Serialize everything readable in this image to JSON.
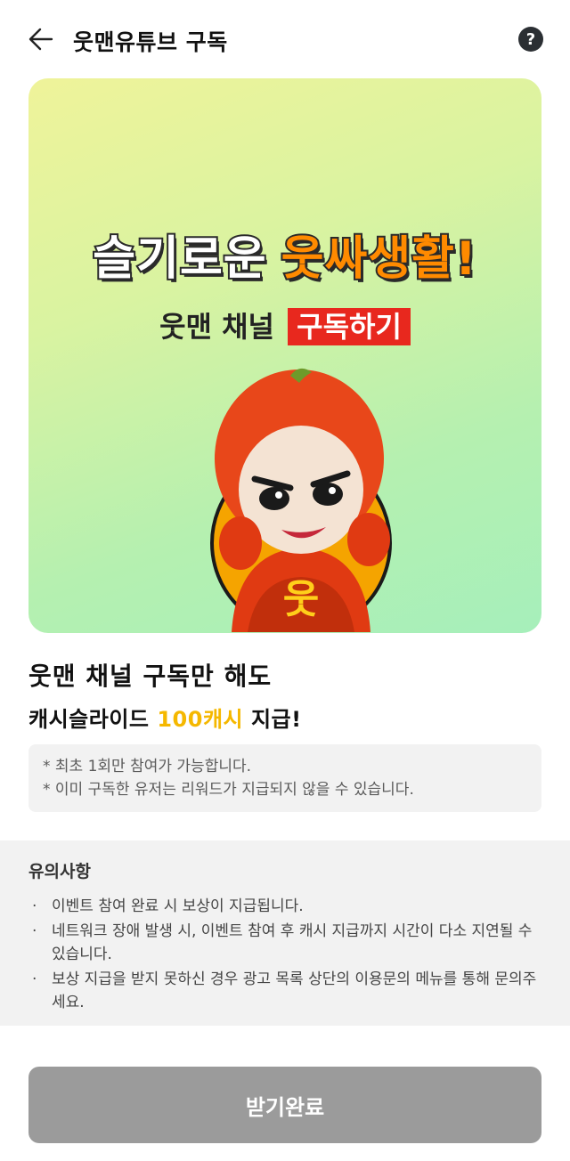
{
  "header": {
    "back_icon": "back-arrow-icon",
    "title": "웃맨유튜브 구독",
    "help_icon": "help-icon",
    "help_glyph": "?"
  },
  "banner": {
    "title_part1": "슬기로운",
    "title_part2": "웃싸생활!",
    "subtitle_part1": "웃맨 채널",
    "subtitle_highlight": "구독하기",
    "mascot_chest_glyph": "웃",
    "colors": {
      "highlight": "#e8281e",
      "title_accent": "#ff8a00"
    }
  },
  "info": {
    "line1": "웃맨 채널 구독만 해도",
    "line2_prefix": "캐시슬라이드 ",
    "line2_amount": "100캐시",
    "line2_suffix": " 지급!",
    "amount_color": "#f5b800",
    "notes": [
      "* 최초 1회만 참여가 가능합니다.",
      "* 이미 구독한 유저는 리워드가 지급되지 않을 수 있습니다."
    ]
  },
  "caution": {
    "title": "유의사항",
    "items": [
      "이벤트 참여 완료 시 보상이 지급됩니다.",
      "네트워크 장애 발생 시, 이벤트 참여 후 캐시 지급까지 시간이 다소 지연될 수 있습니다.",
      "보상 지급을 받지 못하신 경우 광고 목록 상단의 이용문의 메뉴를 통해 문의주세요."
    ],
    "bullet": "·"
  },
  "footer": {
    "button_label": "받기완료",
    "button_color": "#9b9b9b"
  }
}
